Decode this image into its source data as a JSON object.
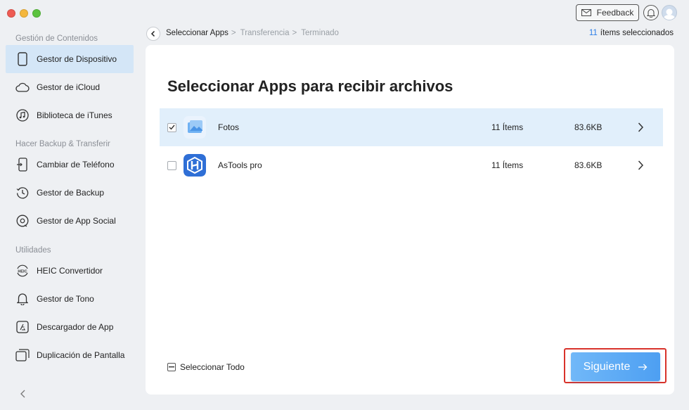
{
  "window": {
    "feedback_label": "Feedback"
  },
  "sidebar": {
    "sections": [
      {
        "label": "Gestión de Contenidos"
      },
      {
        "label": "Hacer Backup & Transferir"
      },
      {
        "label": "Utilidades"
      }
    ],
    "items": [
      {
        "label": "Gestor de Dispositivo",
        "icon": "phone-icon"
      },
      {
        "label": "Gestor de iCloud",
        "icon": "cloud-icon"
      },
      {
        "label": "Biblioteca de iTunes",
        "icon": "music-icon"
      },
      {
        "label": "Cambiar de Teléfono",
        "icon": "phone-switch-icon"
      },
      {
        "label": "Gestor de Backup",
        "icon": "clock-icon"
      },
      {
        "label": "Gestor de App Social",
        "icon": "chat-icon"
      },
      {
        "label": "HEIC Convertidor",
        "icon": "heic-icon",
        "icon_text": "HEIC"
      },
      {
        "label": "Gestor de Tono",
        "icon": "bell-icon"
      },
      {
        "label": "Descargador de App",
        "icon": "app-store-icon"
      },
      {
        "label": "Duplicación de Pantalla",
        "icon": "screen-mirror-icon"
      }
    ]
  },
  "breadcrumb": {
    "steps": [
      "Seleccionar Apps",
      "Transferencia",
      "Terminado"
    ],
    "separator": ">"
  },
  "selection": {
    "count": "11",
    "label": "ítems seleccionados"
  },
  "main": {
    "title": "Seleccionar Apps para recibir archivos",
    "apps": [
      {
        "name": "Fotos",
        "items": "11 Ítems",
        "size": "83.6KB",
        "checked": true,
        "icon": "photos-app-icon"
      },
      {
        "name": "AsTools pro",
        "items": "11 Ítems",
        "size": "83.6KB",
        "checked": false,
        "icon": "astools-app-icon"
      }
    ],
    "select_all_label": "Seleccionar Todo",
    "next_label": "Siguiente"
  },
  "colors": {
    "accent": "#4d9ff2",
    "active_item_bg": "#d4e6f7",
    "highlight_frame": "#d8322a"
  }
}
